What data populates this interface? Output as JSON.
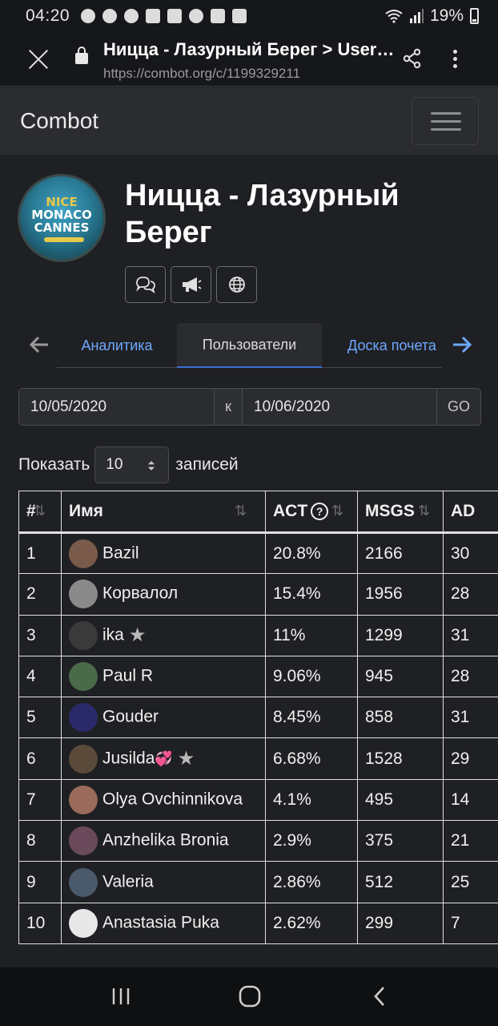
{
  "status_bar": {
    "time": "04:20",
    "battery": "19%",
    "notification_icons": [
      "facebook-icon",
      "facebook-icon",
      "telegram-icon",
      "slack-icon",
      "instagram-icon",
      "translate-icon",
      "google-news-icon",
      "screenshot-icon"
    ]
  },
  "browser": {
    "page_title": "Ницца - Лазурный Берег > Users...",
    "url": "https://combot.org/c/1199329211"
  },
  "navbar": {
    "brand": "Combot"
  },
  "group": {
    "name": "Ницца - Лазурный Берег",
    "logo_lines": [
      "NICE",
      "MONACO",
      "CANNES"
    ],
    "action_icons": [
      "chat-icon",
      "megaphone-icon",
      "globe-icon"
    ]
  },
  "tabs": [
    {
      "label": "Аналитика",
      "active": false
    },
    {
      "label": "Пользователи",
      "active": true
    },
    {
      "label": "Доска почета",
      "active": false
    }
  ],
  "date_range": {
    "from": "10/05/2020",
    "separator": "к",
    "to": "10/06/2020",
    "go_label": "GO"
  },
  "length": {
    "prefix": "Показать",
    "value": "10",
    "suffix": "записей"
  },
  "table": {
    "headers": [
      "#",
      "Имя",
      "ACT",
      "MSGS",
      "AD"
    ],
    "rows": [
      {
        "rank": "1",
        "name": "Bazil",
        "act": "20.8%",
        "msgs": "2166",
        "ad": "30",
        "star": false,
        "hearts": ""
      },
      {
        "rank": "2",
        "name": "Корвалол",
        "act": "15.4%",
        "msgs": "1956",
        "ad": "28",
        "star": false,
        "hearts": ""
      },
      {
        "rank": "3",
        "name": "ika",
        "act": "11%",
        "msgs": "1299",
        "ad": "31",
        "star": true,
        "hearts": ""
      },
      {
        "rank": "4",
        "name": "Paul R",
        "act": "9.06%",
        "msgs": "945",
        "ad": "28",
        "star": false,
        "hearts": ""
      },
      {
        "rank": "5",
        "name": "Gouder",
        "act": "8.45%",
        "msgs": "858",
        "ad": "31",
        "star": false,
        "hearts": ""
      },
      {
        "rank": "6",
        "name": "Jusilda",
        "act": "6.68%",
        "msgs": "1528",
        "ad": "29",
        "star": true,
        "hearts": "💞"
      },
      {
        "rank": "7",
        "name": "Olya Ovchinnikova",
        "act": "4.1%",
        "msgs": "495",
        "ad": "14",
        "star": false,
        "hearts": ""
      },
      {
        "rank": "8",
        "name": "Anzhelika Bronia",
        "act": "2.9%",
        "msgs": "375",
        "ad": "21",
        "star": false,
        "hearts": ""
      },
      {
        "rank": "9",
        "name": "Valeria",
        "act": "2.86%",
        "msgs": "512",
        "ad": "25",
        "star": false,
        "hearts": ""
      },
      {
        "rank": "10",
        "name": "Anastasia Puka",
        "act": "2.62%",
        "msgs": "299",
        "ad": "7",
        "star": false,
        "hearts": ""
      }
    ],
    "avatar_colors": [
      "#7a5a4a",
      "#8a8a8a",
      "#3a3a3a",
      "#4a6a4a",
      "#2a2a6a",
      "#5a4a3a",
      "#9a6a5a",
      "#6a4a5a",
      "#4a5a6a",
      "#e8e8e8"
    ]
  },
  "colors": {
    "link": "#6ea8fe",
    "active_tab_underline": "#3b6fd6",
    "background": "#1f2023",
    "navbar": "#2b2c30"
  }
}
